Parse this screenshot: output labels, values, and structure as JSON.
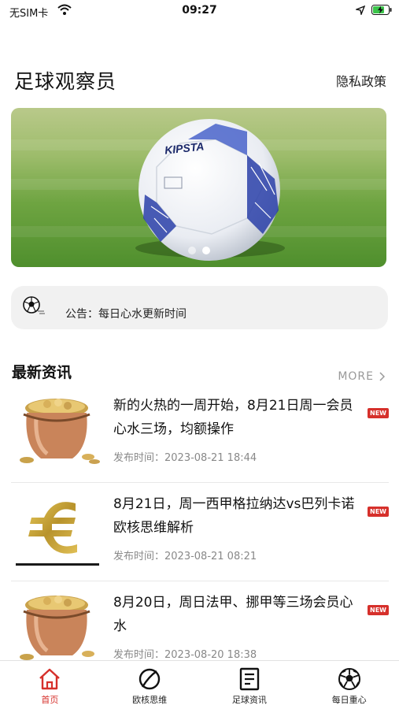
{
  "status_bar": {
    "carrier": "无SIM卡",
    "time": "09:27"
  },
  "header": {
    "title": "足球观察员",
    "privacy_link": "隐私政策"
  },
  "banner": {
    "ball_brand": "KIPSTA",
    "slides": 2,
    "active_slide": 2
  },
  "notice": {
    "icon": "soccer-ball-icon",
    "text": "公告：每日心水更新时间"
  },
  "news_section": {
    "title": "最新资讯",
    "more_label": "MORE",
    "items": [
      {
        "title": "新的火热的一周开始，8月21日周一会员心水三场，均额操作",
        "time": "发布时间：2023-08-21 18:44",
        "badge": "NEW",
        "thumb": "gold-coin-pot-icon"
      },
      {
        "title": "8月21日，周一西甲格拉纳达vs巴列卡诺欧核思维解析",
        "time": "发布时间：2023-08-21 08:21",
        "badge": "NEW",
        "thumb": "euro-sign-icon"
      },
      {
        "title": "8月20日，周日法甲、挪甲等三场会员心水",
        "time": "发布时间：2023-08-20 18:38",
        "badge": "NEW",
        "thumb": "gold-coin-pot-icon"
      }
    ]
  },
  "tab_bar": {
    "active_color": "#d6302b",
    "tabs": [
      {
        "label": "首页",
        "icon": "home-icon",
        "active": true
      },
      {
        "label": "欧核思维",
        "icon": "planet-icon",
        "active": false
      },
      {
        "label": "足球资讯",
        "icon": "document-icon",
        "active": false
      },
      {
        "label": "每日重心",
        "icon": "soccer-ball-icon",
        "active": false
      }
    ]
  }
}
